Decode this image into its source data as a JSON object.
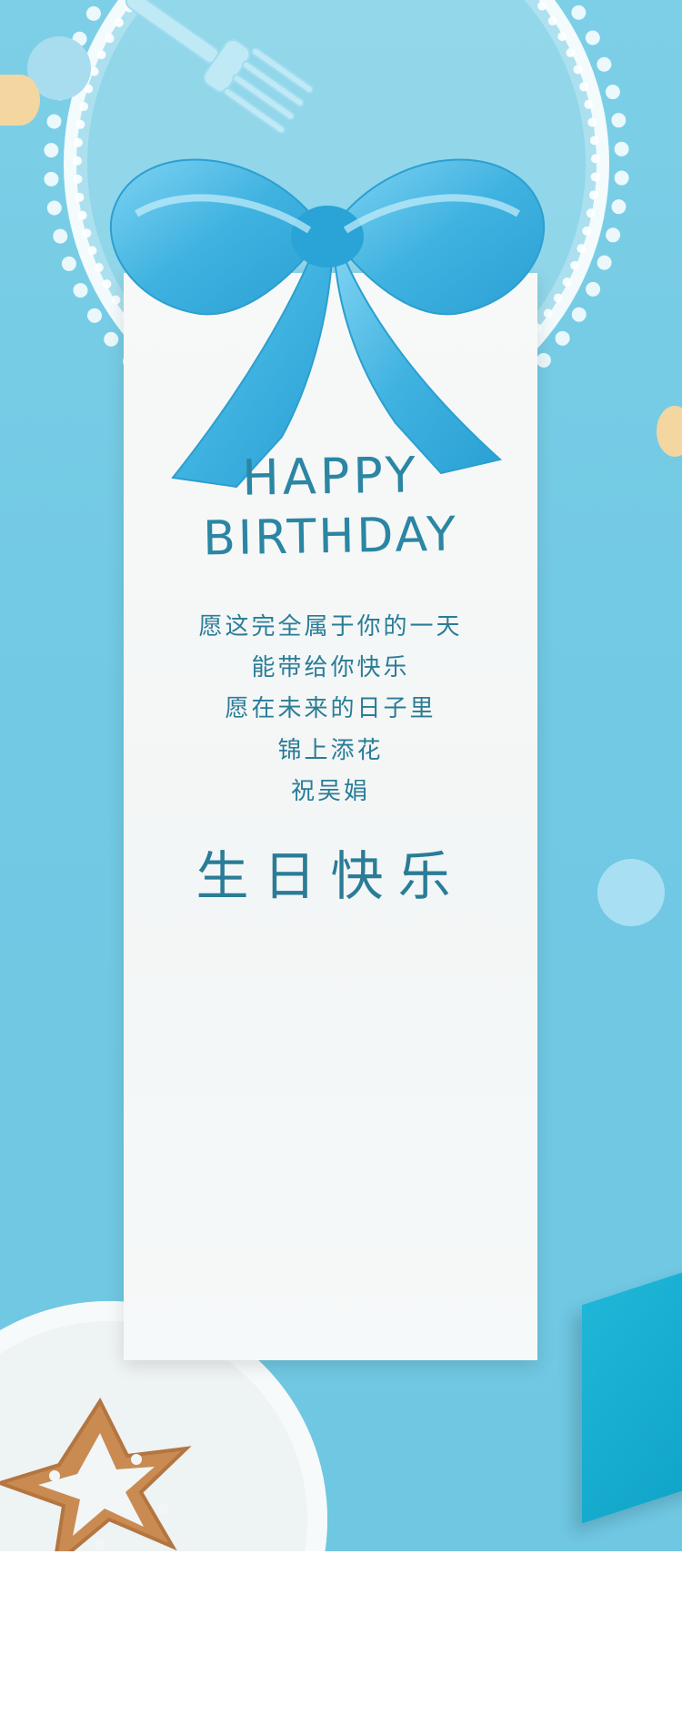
{
  "card": {
    "heading_line1": "HAPPY",
    "heading_line2": "BIRTHDAY",
    "message_lines": [
      "愿这完全属于你的一天",
      "能带给你快乐",
      "愿在未来的日子里",
      "锦上添花",
      "祝吴娟"
    ],
    "closing": "生日快乐"
  },
  "colors": {
    "background": "#74cbe5",
    "card": "#f5f8f8",
    "text": "#2a7c97",
    "ribbon": "#46b8e4",
    "accent_yellow": "#f3d6a0"
  }
}
